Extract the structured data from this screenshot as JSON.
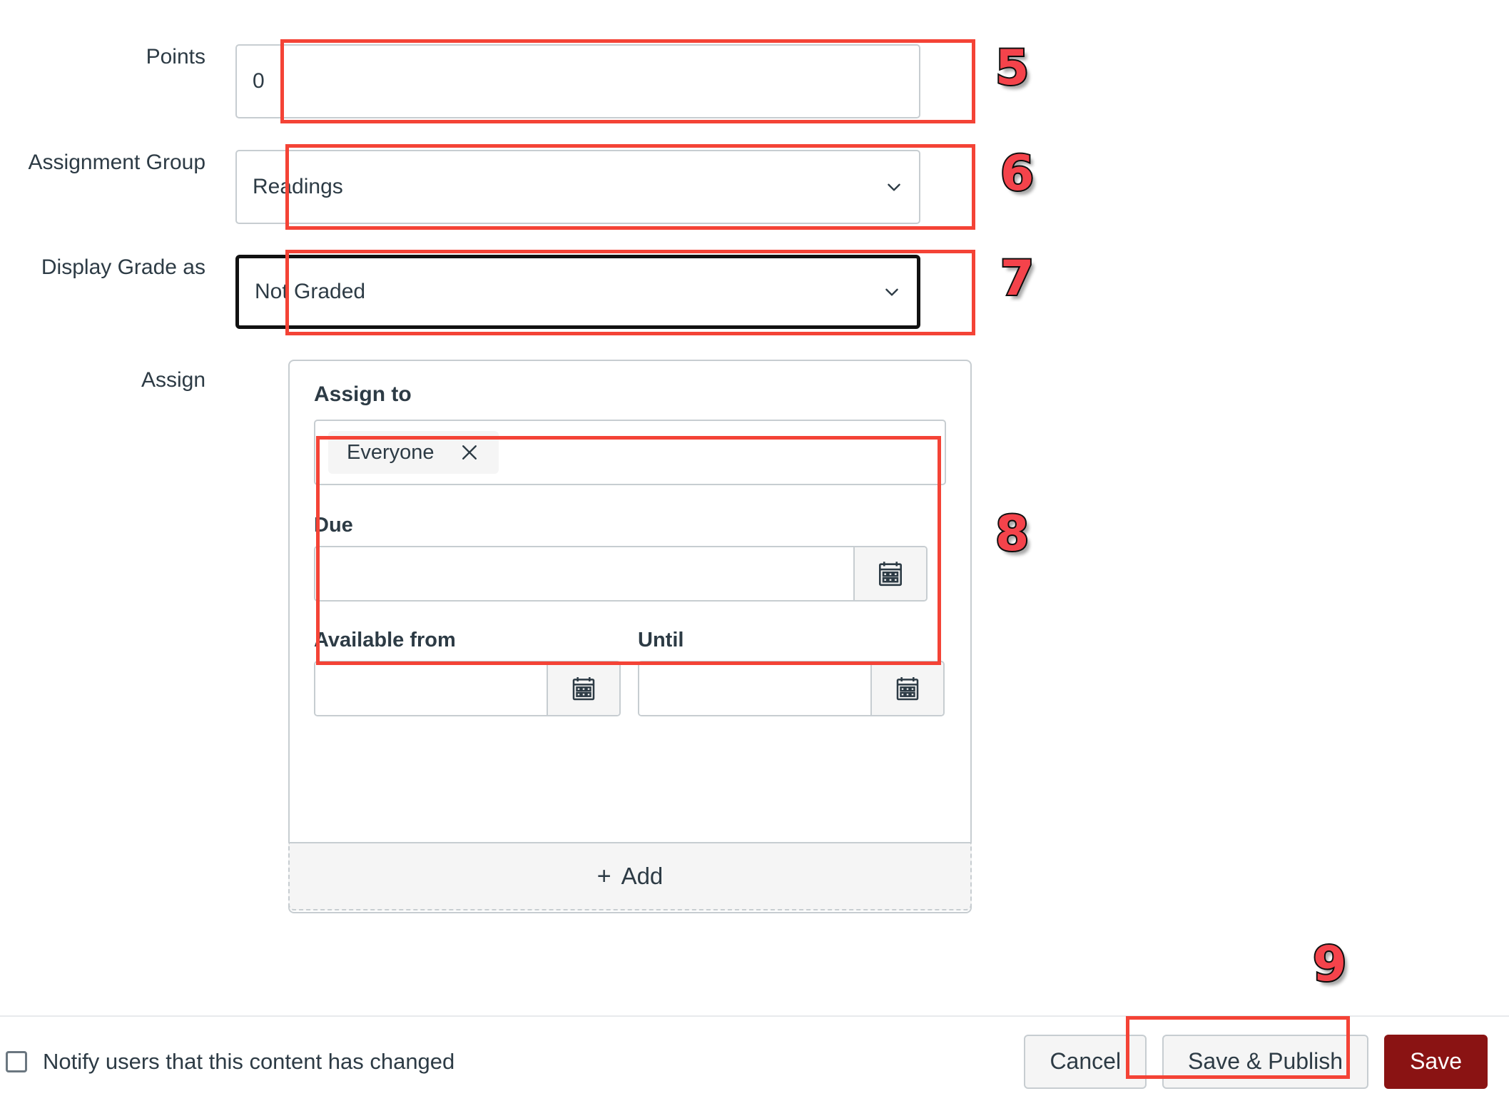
{
  "form": {
    "rows": [
      {
        "label": "Points",
        "type": "text",
        "value": "0",
        "annotation": "5"
      },
      {
        "label": "Assignment Group",
        "type": "select",
        "value": "Readings",
        "annotation": "6"
      },
      {
        "label": "Display Grade as",
        "type": "select",
        "value": "Not Graded",
        "annotation": "7",
        "focused": true
      },
      {
        "label": "Assign",
        "type": "card",
        "annotation": "8"
      }
    ]
  },
  "assign_card": {
    "assign_to_label": "Assign to",
    "assign_to_tokens": [
      {
        "label": "Everyone",
        "remove_icon": "close-icon"
      }
    ],
    "due_label": "Due",
    "due_value": "",
    "due_calendar_icon": "calendar-icon",
    "available_from_label": "Available from",
    "available_from_value": "",
    "available_from_calendar_icon": "calendar-icon",
    "until_label": "Until",
    "until_value": "",
    "until_calendar_icon": "calendar-icon",
    "add_label": "Add",
    "add_plus_icon": "plus-icon"
  },
  "footer": {
    "notify_label": "Notify users that this content has changed",
    "notify_checked": false,
    "cancel_label": "Cancel",
    "save_publish_label": "Save & Publish",
    "save_label": "Save",
    "save_publish_annotation": "9"
  },
  "colors": {
    "annotation_red": "#F44336",
    "annotation_number_fill": "#F4434B",
    "annotation_number_stroke": "#111111",
    "primary_button_bg": "#8A1313",
    "text": "#2D3B45",
    "border": "#C7CDD1",
    "field_fill": "#F5F5F5"
  }
}
